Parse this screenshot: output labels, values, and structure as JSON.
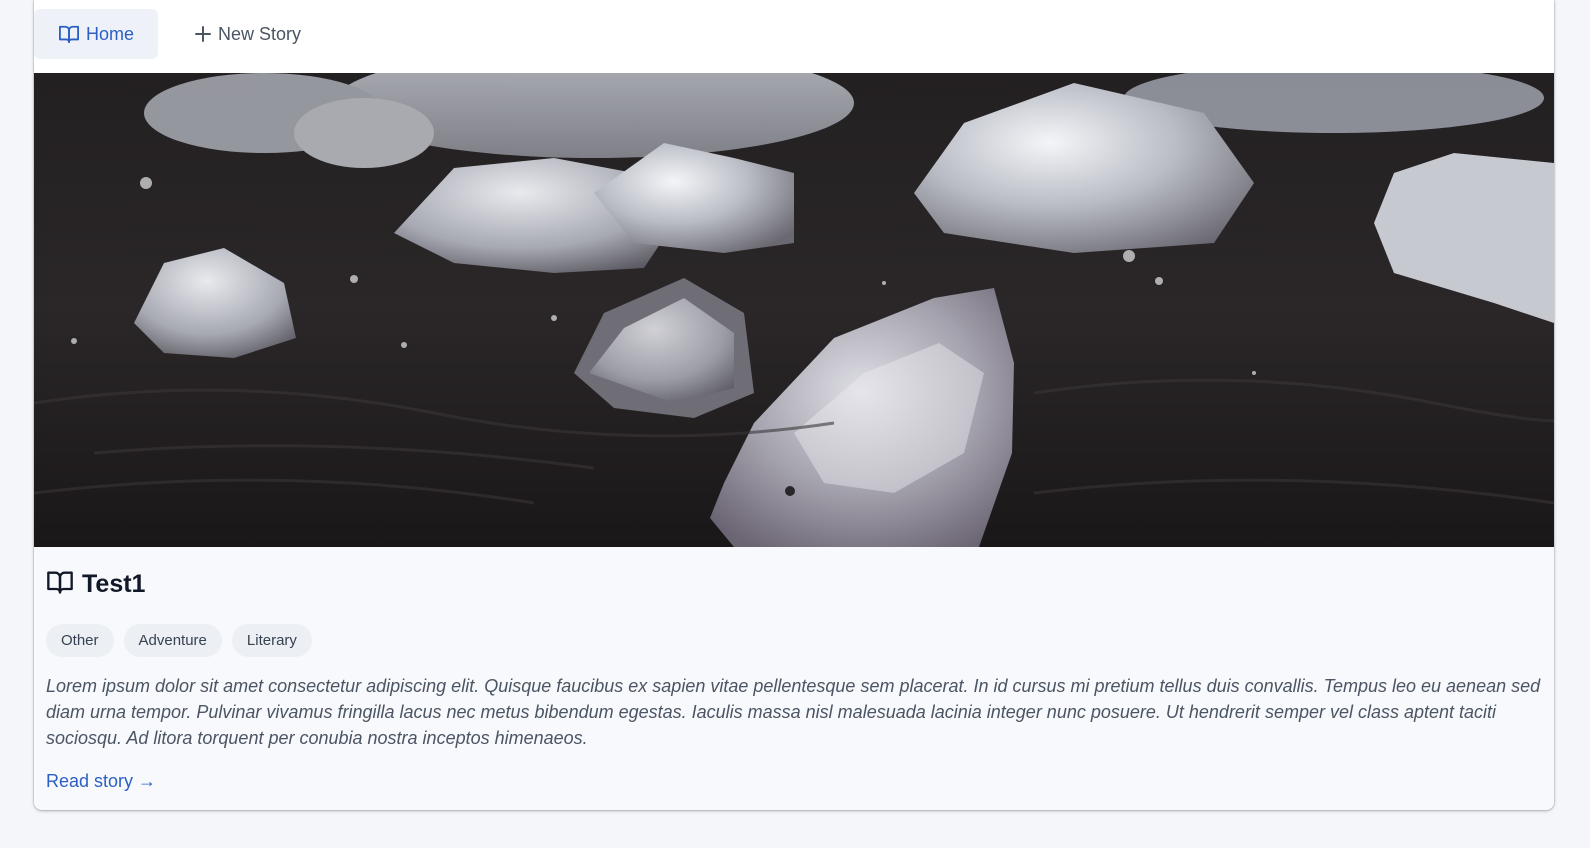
{
  "nav": {
    "items": [
      {
        "label": "Home",
        "icon": "book-open-icon",
        "active": true
      },
      {
        "label": "New Story",
        "icon": "plus-icon",
        "active": false
      }
    ]
  },
  "story": {
    "title": "Test1",
    "title_icon": "book-open-icon",
    "tags": [
      "Other",
      "Adventure",
      "Literary"
    ],
    "description": "Lorem ipsum dolor sit amet consectetur adipiscing elit. Quisque faucibus ex sapien vitae pellentesque sem placerat. In id cursus mi pretium tellus duis convallis. Tempus leo eu aenean sed diam urna tempor. Pulvinar vivamus fringilla lacus nec metus bibendum egestas. Iaculis massa nisl malesuada lacinia integer nunc posuere. Ut hendrerit semper vel class aptent taciti sociosqu. Ad litora torquent per conubia nostra inceptos himenaeos.",
    "read_link": "Read story →"
  },
  "colors": {
    "accent": "#2b5fc4",
    "page_bg": "#f4f6fa",
    "card_bg": "#f8f9fc"
  }
}
